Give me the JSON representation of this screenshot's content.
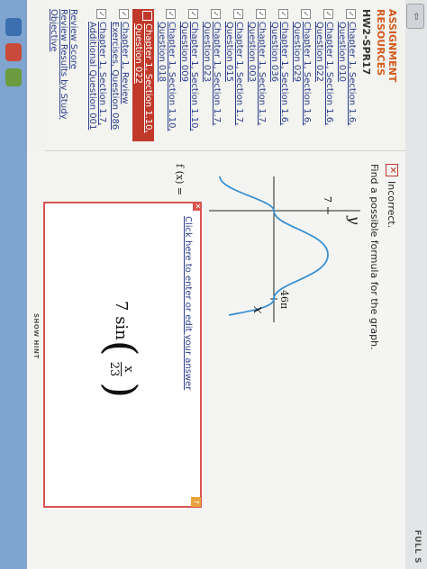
{
  "chrome": {
    "tab_icon": "⇦",
    "fullscreen_label": "FULL S"
  },
  "sidebar": {
    "title": "ASSIGNMENT RESOURCES",
    "assignment": "HW2-SPR17",
    "questions": [
      {
        "check": "✓",
        "label": "Chapter 1, Section 1.6, Question 010"
      },
      {
        "check": "✓",
        "label": "Chapter 1, Section 1.6, Question 022"
      },
      {
        "check": "✓",
        "label": "Chapter 1, Section 1.6, Question 029"
      },
      {
        "check": "✓",
        "label": "Chapter 1, Section 1.6, Question 036"
      },
      {
        "check": "✓",
        "label": "Chapter 1, Section 1.7, Question 003"
      },
      {
        "check": "✓",
        "label": "Chapter 1, Section 1.7, Question 015"
      },
      {
        "check": "✓",
        "label": "Chapter 1, Section 1.7, Question 023"
      },
      {
        "check": "✓",
        "label": "Chapter 1, Section 1.10, Question 009"
      },
      {
        "check": "✓",
        "label": "Chapter 1, Section 1.10, Question 018"
      },
      {
        "check": "·",
        "label": "Chapter 1, Section 1.10, Question 022"
      },
      {
        "check": "✓",
        "label": "Chapter 1, Review Exercises, Question 086"
      },
      {
        "check": "✓",
        "label": "Chapter 1, Section 1.7, Additional Question 001"
      }
    ],
    "review_score": "Review Score",
    "review_results": "Review Results by Study Objective"
  },
  "main": {
    "status": "Incorrect.",
    "prompt": "Find a possible formula for the graph.",
    "fx_label": "f (x) =",
    "edit_link": "Click here to enter or edit your answer",
    "answer": {
      "coefficient": "7",
      "func": "sin",
      "numerator": "x",
      "denominator": "23"
    },
    "show_hint": "SHOW HINT"
  },
  "graph": {
    "y_axis_label": "y",
    "x_axis_label": "x",
    "y_tick_label": "7",
    "x_tick_label": "46π",
    "curve_color": "#3a8fd0"
  }
}
